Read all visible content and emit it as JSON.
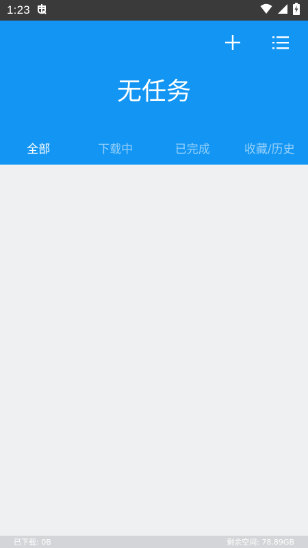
{
  "status_bar": {
    "time": "1:23",
    "app_icon": "bug-icon",
    "icons": [
      "wifi-icon",
      "signal-icon",
      "battery-charging-icon"
    ]
  },
  "header": {
    "add_icon": "plus-icon",
    "menu_icon": "list-icon",
    "empty_title": "无任务",
    "background_color": "#1396f3"
  },
  "tabs": [
    {
      "label": "全部",
      "active": true
    },
    {
      "label": "下载中",
      "active": false
    },
    {
      "label": "已完成",
      "active": false
    },
    {
      "label": "收藏/历史",
      "active": false
    }
  ],
  "footer": {
    "downloaded": "已下载: 0B",
    "free_space": "剩余空间: 78.89GB"
  }
}
